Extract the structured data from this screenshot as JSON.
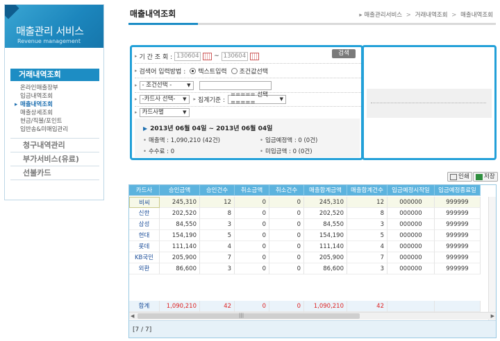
{
  "sidebar": {
    "brand_title": "매출관리 서비스",
    "brand_sub": "Revenue management",
    "section_title": "거래내역조회",
    "items": [
      {
        "label": "온라인매출장부",
        "active": false
      },
      {
        "label": "입금내역조회",
        "active": false
      },
      {
        "label": "매출내역조회",
        "active": true
      },
      {
        "label": "매출상세조회",
        "active": false
      },
      {
        "label": "현금/직불/포인트",
        "active": false
      },
      {
        "label": "입반송&미매입관리",
        "active": false
      }
    ],
    "groups": [
      "청구내역관리",
      "부가서비스(유료)",
      "선불카드"
    ]
  },
  "header": {
    "title": "매출내역조회",
    "breadcrumb": [
      "매출관리서비스",
      "거래내역조회",
      "매출내역조회"
    ]
  },
  "search": {
    "period_label": "기 간 조 회 :",
    "date_from": "130604",
    "date_to": "130604",
    "tilde": "~",
    "search_button": "검색",
    "method_label": "검색어 입력방법 :",
    "radio_text": "텍스트입력",
    "radio_select": "조건값선택",
    "condition_select": "- 조건선택 -",
    "card_select": "-카드사 선택-",
    "agg_label": "집계기준 :",
    "agg_select": "===== 선택 =====",
    "card_by_select": "카드사별"
  },
  "summary": {
    "period": "2013년 06월 04일 ~ 2013년 06월 04일",
    "sales_label": "매출액 : 1,090,210 (42건)",
    "expected_label": "입금예정액 : 0 (0건)",
    "fee_label": "수수료 : 0",
    "unpaid_label": "미입금액 : 0 (0건)"
  },
  "tools": {
    "print": "인쇄",
    "save": "저장"
  },
  "grid": {
    "columns": [
      "카드사",
      "승인금액",
      "승인건수",
      "취소금액",
      "취소건수",
      "매출합계금액",
      "매출합계건수",
      "입금예정시작일",
      "입금예정종료일"
    ],
    "rows": [
      [
        "비씨",
        "245,310",
        "12",
        "0",
        "0",
        "245,310",
        "12",
        "000000",
        "999999"
      ],
      [
        "신한",
        "202,520",
        "8",
        "0",
        "0",
        "202,520",
        "8",
        "000000",
        "999999"
      ],
      [
        "삼성",
        "84,550",
        "3",
        "0",
        "0",
        "84,550",
        "3",
        "000000",
        "999999"
      ],
      [
        "현대",
        "154,190",
        "5",
        "0",
        "0",
        "154,190",
        "5",
        "000000",
        "999999"
      ],
      [
        "롯데",
        "111,140",
        "4",
        "0",
        "0",
        "111,140",
        "4",
        "000000",
        "999999"
      ],
      [
        "KB국민",
        "205,900",
        "7",
        "0",
        "0",
        "205,900",
        "7",
        "000000",
        "999999"
      ],
      [
        "외환",
        "86,600",
        "3",
        "0",
        "0",
        "86,600",
        "3",
        "000000",
        "999999"
      ]
    ],
    "total": [
      "합계",
      "1,090,210",
      "42",
      "0",
      "0",
      "1,090,210",
      "42",
      "",
      ""
    ],
    "page_status": "[7 / 7]"
  },
  "colors": {
    "accent": "#22a0d8",
    "header_bg": "#5cb3de",
    "total_text": "#dd2222"
  }
}
